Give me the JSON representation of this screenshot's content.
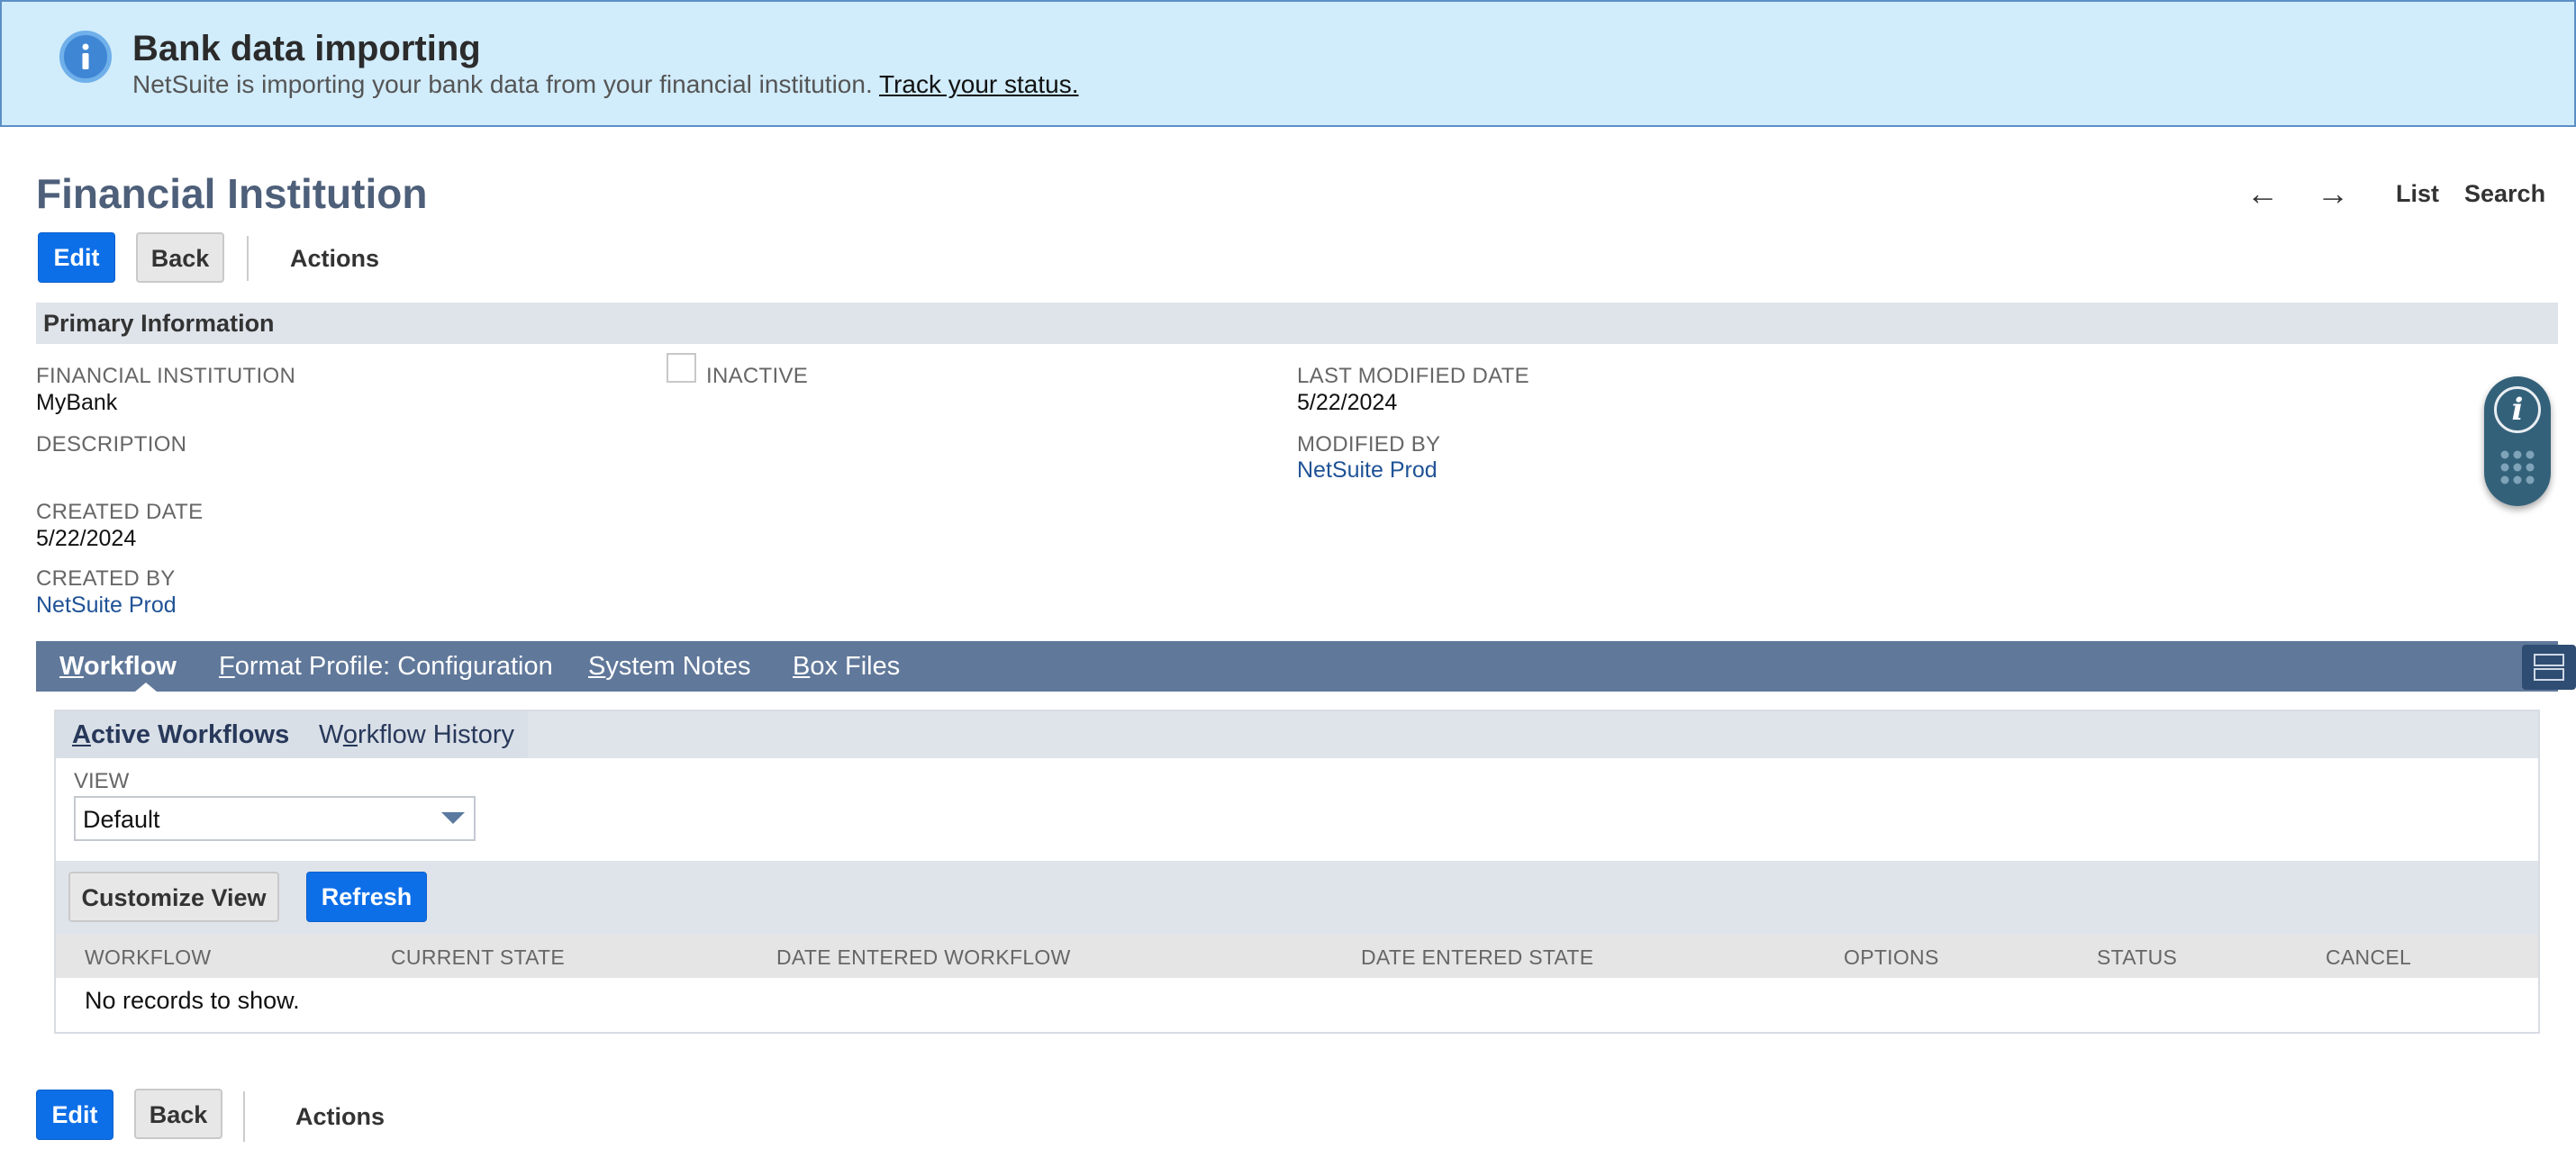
{
  "banner": {
    "title": "Bank data importing",
    "text": "NetSuite is importing your bank data from your financial institution. ",
    "link": "Track your status.",
    "icon": "info-icon"
  },
  "header": {
    "title": "Financial Institution",
    "nav": {
      "prev": "←",
      "next": "→",
      "list": "List",
      "search": "Search"
    }
  },
  "toolbar": {
    "edit": "Edit",
    "back": "Back",
    "actions": "Actions"
  },
  "primary": {
    "section_title": "Primary Information",
    "financial_institution_label": "FINANCIAL INSTITUTION",
    "financial_institution_value": "MyBank",
    "inactive_label": "INACTIVE",
    "description_label": "DESCRIPTION",
    "created_date_label": "CREATED DATE",
    "created_date_value": "5/22/2024",
    "created_by_label": "CREATED BY",
    "created_by_value": "NetSuite Prod",
    "last_modified_label": "LAST MODIFIED DATE",
    "last_modified_value": "5/22/2024",
    "modified_by_label": "MODIFIED BY",
    "modified_by_value": "NetSuite Prod"
  },
  "tabs": {
    "workflow": {
      "key": "W",
      "rest": "orkflow"
    },
    "format_profile": {
      "key": "F",
      "rest": "ormat Profile: Configuration"
    },
    "system_notes": {
      "key": "S",
      "rest": "ystem Notes"
    },
    "box_files": {
      "key": "B",
      "rest": "ox Files"
    }
  },
  "subtabs": {
    "active": {
      "key": "A",
      "rest": "ctive Workflows"
    },
    "history": {
      "pre": "W",
      "key": "o",
      "rest": "rkflow History"
    }
  },
  "view": {
    "label": "VIEW",
    "selected": "Default"
  },
  "list_buttons": {
    "customize": "Customize View",
    "refresh": "Refresh"
  },
  "table": {
    "columns": [
      "WORKFLOW",
      "CURRENT STATE",
      "DATE ENTERED WORKFLOW",
      "DATE ENTERED STATE",
      "OPTIONS",
      "STATUS",
      "CANCEL"
    ],
    "empty": "No records to show."
  },
  "colors": {
    "primary_button": "#0d6fe8",
    "tab_bar": "#60789a",
    "banner_bg": "#d1ecfb",
    "link": "#1f5296"
  }
}
